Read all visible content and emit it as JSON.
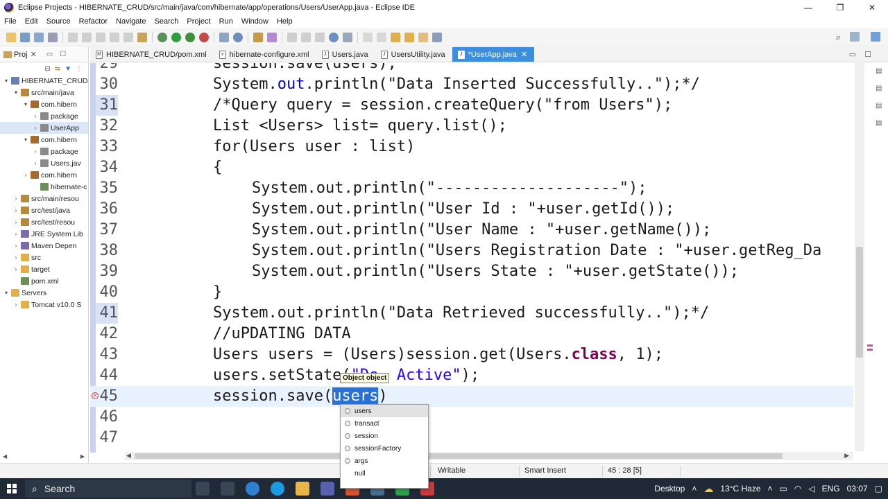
{
  "window": {
    "title": "Eclipse Projects - HIBERNATE_CRUD/src/main/java/com/hibernate/app/operations/Users/UserApp.java - Eclipse IDE",
    "controls": [
      "—",
      "❐",
      "✕"
    ]
  },
  "menu": [
    "File",
    "Edit",
    "Source",
    "Refactor",
    "Navigate",
    "Search",
    "Project",
    "Run",
    "Window",
    "Help"
  ],
  "explorer": {
    "tab_label": "Proj",
    "items": [
      {
        "label": "HIBERNATE_CRUD",
        "twisty": "▾",
        "icon": "project-icon",
        "color": "#6b7fb2",
        "indent": 0
      },
      {
        "label": "src/main/java",
        "twisty": "▾",
        "icon": "source-folder-icon",
        "color": "#b68a3c",
        "indent": 1
      },
      {
        "label": "com.hibern",
        "twisty": "▾",
        "icon": "package-icon",
        "color": "#a46a2e",
        "indent": 2
      },
      {
        "label": "package",
        "twisty": "›",
        "icon": "java-file-icon",
        "color": "#8a8a8a",
        "indent": 3
      },
      {
        "label": "UserApp",
        "twisty": "›",
        "icon": "java-file-icon",
        "color": "#8a8a8a",
        "indent": 3,
        "selected": true
      },
      {
        "label": "com.hibern",
        "twisty": "▾",
        "icon": "package-icon",
        "color": "#a46a2e",
        "indent": 2
      },
      {
        "label": "package",
        "twisty": "›",
        "icon": "java-file-icon",
        "color": "#8a8a8a",
        "indent": 3
      },
      {
        "label": "Users.jav",
        "twisty": "›",
        "icon": "java-file-icon",
        "color": "#8a8a8a",
        "indent": 3
      },
      {
        "label": "com.hibern",
        "twisty": "›",
        "icon": "package-icon",
        "color": "#a46a2e",
        "indent": 2
      },
      {
        "label": "hibernate-c",
        "twisty": "",
        "icon": "xml-file-icon",
        "color": "#6b8e5a",
        "indent": 3
      },
      {
        "label": "src/main/resou",
        "twisty": "›",
        "icon": "source-folder-icon",
        "color": "#b68a3c",
        "indent": 1
      },
      {
        "label": "src/test/java",
        "twisty": "›",
        "icon": "source-folder-icon",
        "color": "#b68a3c",
        "indent": 1
      },
      {
        "label": "src/test/resou",
        "twisty": "›",
        "icon": "source-folder-icon",
        "color": "#b68a3c",
        "indent": 1
      },
      {
        "label": "JRE System Lib",
        "twisty": "›",
        "icon": "library-icon",
        "color": "#7d6aa8",
        "indent": 1
      },
      {
        "label": "Maven Depen",
        "twisty": "›",
        "icon": "library-icon",
        "color": "#7d6aa8",
        "indent": 1
      },
      {
        "label": "src",
        "twisty": "›",
        "icon": "folder-icon",
        "color": "#e2b04a",
        "indent": 1
      },
      {
        "label": "target",
        "twisty": "›",
        "icon": "folder-icon",
        "color": "#e2b04a",
        "indent": 1
      },
      {
        "label": "pom.xml",
        "twisty": "",
        "icon": "xml-file-icon",
        "color": "#6b8e5a",
        "indent": 1
      },
      {
        "label": "Servers",
        "twisty": "▾",
        "icon": "folder-icon",
        "color": "#e2b04a",
        "indent": 0
      },
      {
        "label": "Tomcat v10.0 S",
        "twisty": "›",
        "icon": "folder-icon",
        "color": "#e2b04a",
        "indent": 1
      }
    ]
  },
  "editor_tabs": [
    {
      "label": "HIBERNATE_CRUD/pom.xml",
      "icon": "M",
      "active": false
    },
    {
      "label": "hibernate-configure.xml",
      "icon": "x",
      "active": false
    },
    {
      "label": "Users.java",
      "icon": "J",
      "active": false
    },
    {
      "label": "UsersUtility.java",
      "icon": "J",
      "active": false
    },
    {
      "label": "*UserApp.java",
      "icon": "J",
      "active": true
    }
  ],
  "code": {
    "lines": [
      {
        "n": "29",
        "indent": 0,
        "segments": [
          {
            "t": "session.save(users);",
            "c": ""
          }
        ]
      },
      {
        "n": "30",
        "indent": 0,
        "segments": [
          {
            "t": "System.",
            "c": ""
          },
          {
            "t": "out",
            "c": "fld"
          },
          {
            "t": ".println(\"Data Inserted Successfully..\");*/",
            "c": ""
          }
        ]
      },
      {
        "n": "31",
        "indent": 0,
        "marked": true,
        "segments": [
          {
            "t": "/*Query query = session.createQuery(\"from Users\");",
            "c": ""
          }
        ]
      },
      {
        "n": "32",
        "indent": 0,
        "segments": [
          {
            "t": "List <Users> list= query.list();",
            "c": ""
          }
        ]
      },
      {
        "n": "33",
        "indent": 0,
        "segments": [
          {
            "t": "for(Users user : list)",
            "c": ""
          }
        ]
      },
      {
        "n": "34",
        "indent": 0,
        "segments": [
          {
            "t": "{",
            "c": ""
          }
        ]
      },
      {
        "n": "35",
        "indent": 1,
        "segments": [
          {
            "t": "System.out.println(\"--------------------\");",
            "c": ""
          }
        ]
      },
      {
        "n": "36",
        "indent": 1,
        "segments": [
          {
            "t": "System.out.println(\"User Id : \"+user.getId());",
            "c": ""
          }
        ]
      },
      {
        "n": "37",
        "indent": 1,
        "segments": [
          {
            "t": "System.out.println(\"User Name : \"+user.getName());",
            "c": ""
          }
        ]
      },
      {
        "n": "38",
        "indent": 1,
        "segments": [
          {
            "t": "System.out.println(\"Users Registration Date : \"+user.getReg_Da",
            "c": ""
          }
        ]
      },
      {
        "n": "39",
        "indent": 1,
        "segments": [
          {
            "t": "System.out.println(\"Users State : \"+user.getState());",
            "c": ""
          }
        ]
      },
      {
        "n": "40",
        "indent": 0,
        "segments": [
          {
            "t": "}",
            "c": ""
          }
        ]
      },
      {
        "n": "41",
        "indent": 0,
        "marked": true,
        "segments": [
          {
            "t": "System.out.println(\"Data Retrieved successfully..\");*/",
            "c": ""
          }
        ]
      },
      {
        "n": "42",
        "indent": 0,
        "segments": [
          {
            "t": "//uPDATING DATA",
            "c": ""
          }
        ]
      },
      {
        "n": "43",
        "indent": 0,
        "segments": [
          {
            "t": "Users users = (Users)session.get(Users.",
            "c": ""
          },
          {
            "t": "class",
            "c": "kw"
          },
          {
            "t": ", 1);",
            "c": ""
          }
        ]
      },
      {
        "n": "44",
        "indent": 0,
        "segments": [
          {
            "t": "users.setState(",
            "c": ""
          },
          {
            "t": "\"De  Active\"",
            "c": "str"
          },
          {
            "t": ");",
            "c": ""
          }
        ]
      },
      {
        "n": "45",
        "indent": 0,
        "current": true,
        "error": true,
        "segments": [
          {
            "t": "session.save(",
            "c": ""
          },
          {
            "t": "users",
            "c": "sel"
          },
          {
            "t": ")",
            "c": ""
          }
        ]
      },
      {
        "n": "46",
        "indent": 0,
        "segments": [
          {
            "t": "",
            "c": ""
          }
        ]
      },
      {
        "n": "47",
        "indent": 0,
        "segments": [
          {
            "t": "",
            "c": ""
          }
        ]
      }
    ]
  },
  "param_hint": "Object object",
  "content_assist": {
    "items": [
      {
        "label": "users",
        "selected": true,
        "icon": true
      },
      {
        "label": "transact",
        "icon": true
      },
      {
        "label": "session",
        "icon": true
      },
      {
        "label": "sessionFactory",
        "icon": true
      },
      {
        "label": "args",
        "icon": true
      },
      {
        "label": "null",
        "icon": false
      }
    ]
  },
  "status": {
    "mode": "Writable",
    "insert": "Smart Insert",
    "position": "45 : 28 [5]"
  },
  "taskbar": {
    "search_label": "Search",
    "desktop_label": "Desktop",
    "weather": "13°C  Haze",
    "lang": "ENG",
    "time": "03:07"
  },
  "colors": {
    "active_tab": "#3b8fdc",
    "selection": "#2a71d6",
    "current_line": "#e8f2fe",
    "taskbar": "#1f2a36"
  }
}
